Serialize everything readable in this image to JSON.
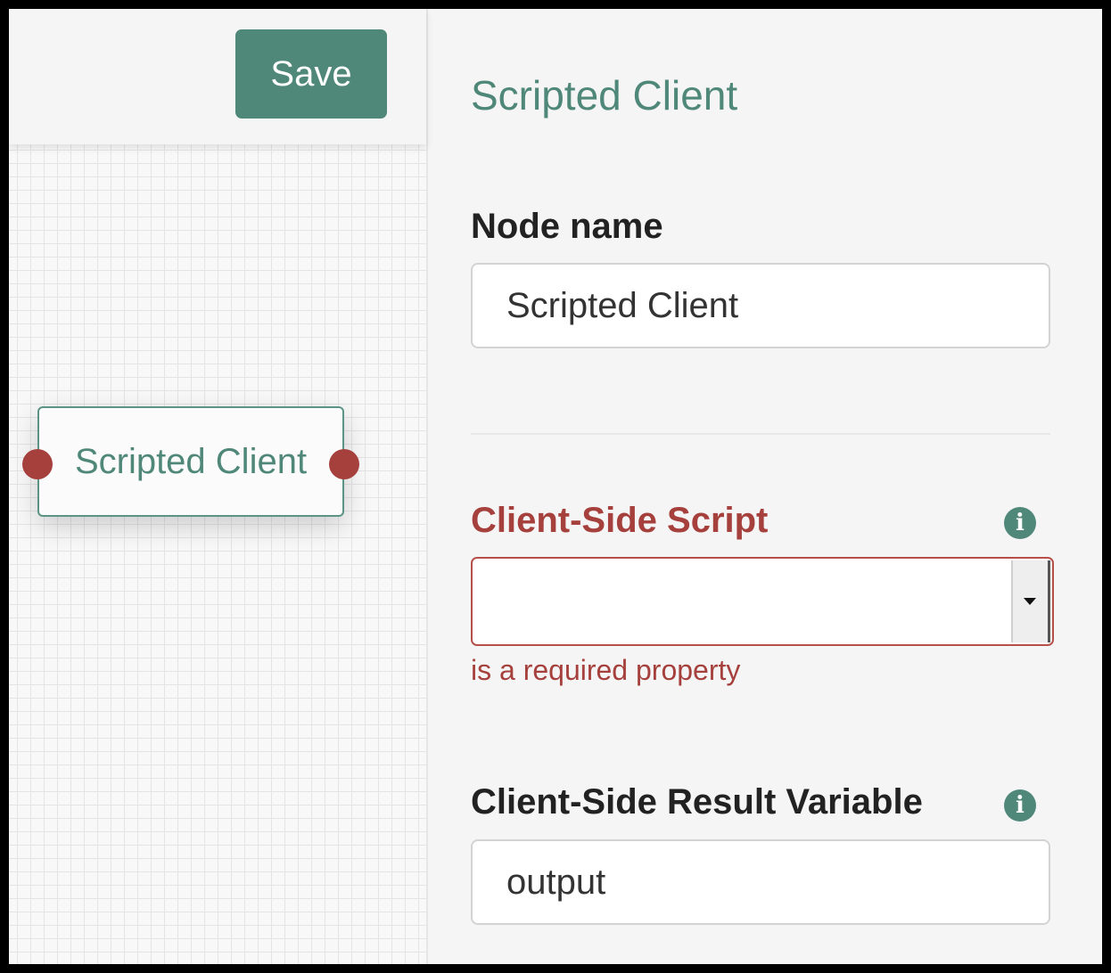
{
  "toolbar": {
    "save_label": "Save"
  },
  "canvas": {
    "node": {
      "label": "Scripted Client"
    }
  },
  "properties": {
    "title": "Scripted Client",
    "node_name": {
      "label": "Node name",
      "value": "Scripted Client"
    },
    "client_side_script": {
      "label": "Client-Side Script",
      "value": "",
      "error": "is a required property",
      "info_icon": "info-icon"
    },
    "client_side_result_variable": {
      "label": "Client-Side Result Variable",
      "value": "output",
      "info_icon": "info-icon"
    }
  },
  "colors": {
    "accent": "#4f8779",
    "error": "#a5403c",
    "panel_bg": "#f5f5f5"
  }
}
